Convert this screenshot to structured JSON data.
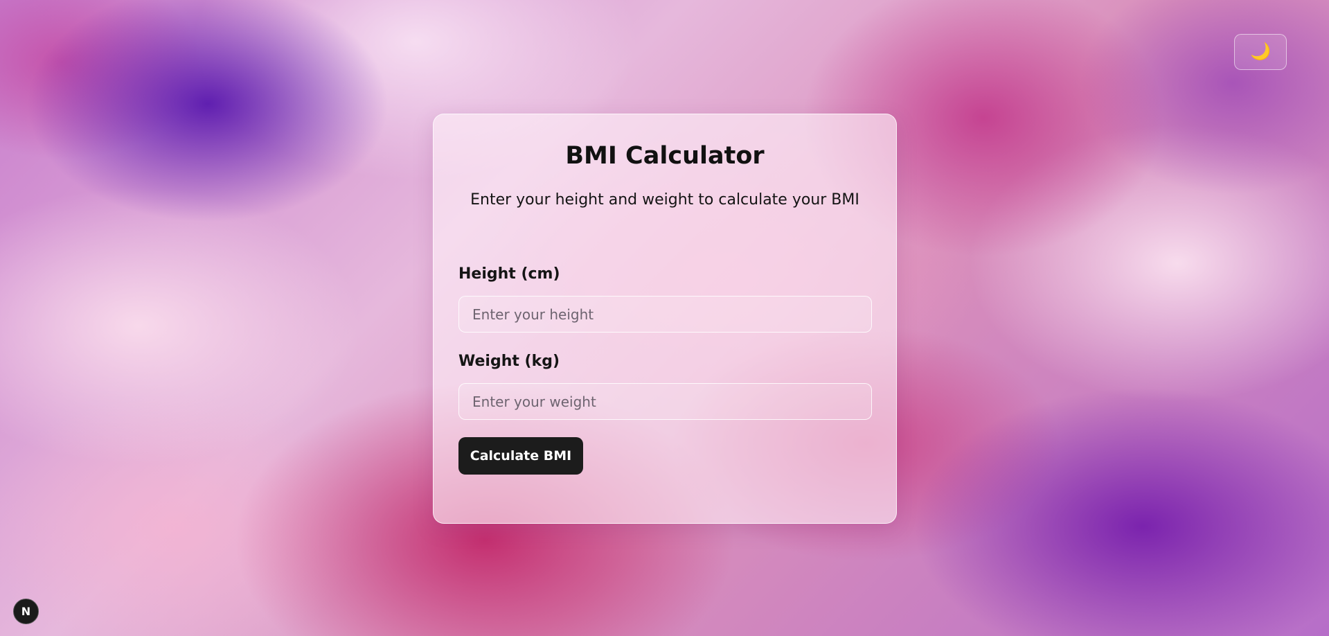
{
  "theme_toggle": {
    "icon": "moon-icon",
    "glyph": "🌙"
  },
  "card": {
    "title": "BMI Calculator",
    "subtitle": "Enter your height and weight to calculate your BMI",
    "height": {
      "label": "Height (cm)",
      "placeholder": "Enter your height",
      "value": ""
    },
    "weight": {
      "label": "Weight (kg)",
      "placeholder": "Enter your weight",
      "value": ""
    },
    "button_label": "Calculate BMI"
  },
  "dev_badge": {
    "icon": "nextjs-logo-icon",
    "glyph": "N"
  },
  "colors": {
    "button_bg": "#1c1c1c",
    "button_text": "#ffffff",
    "text_primary": "#111111"
  }
}
